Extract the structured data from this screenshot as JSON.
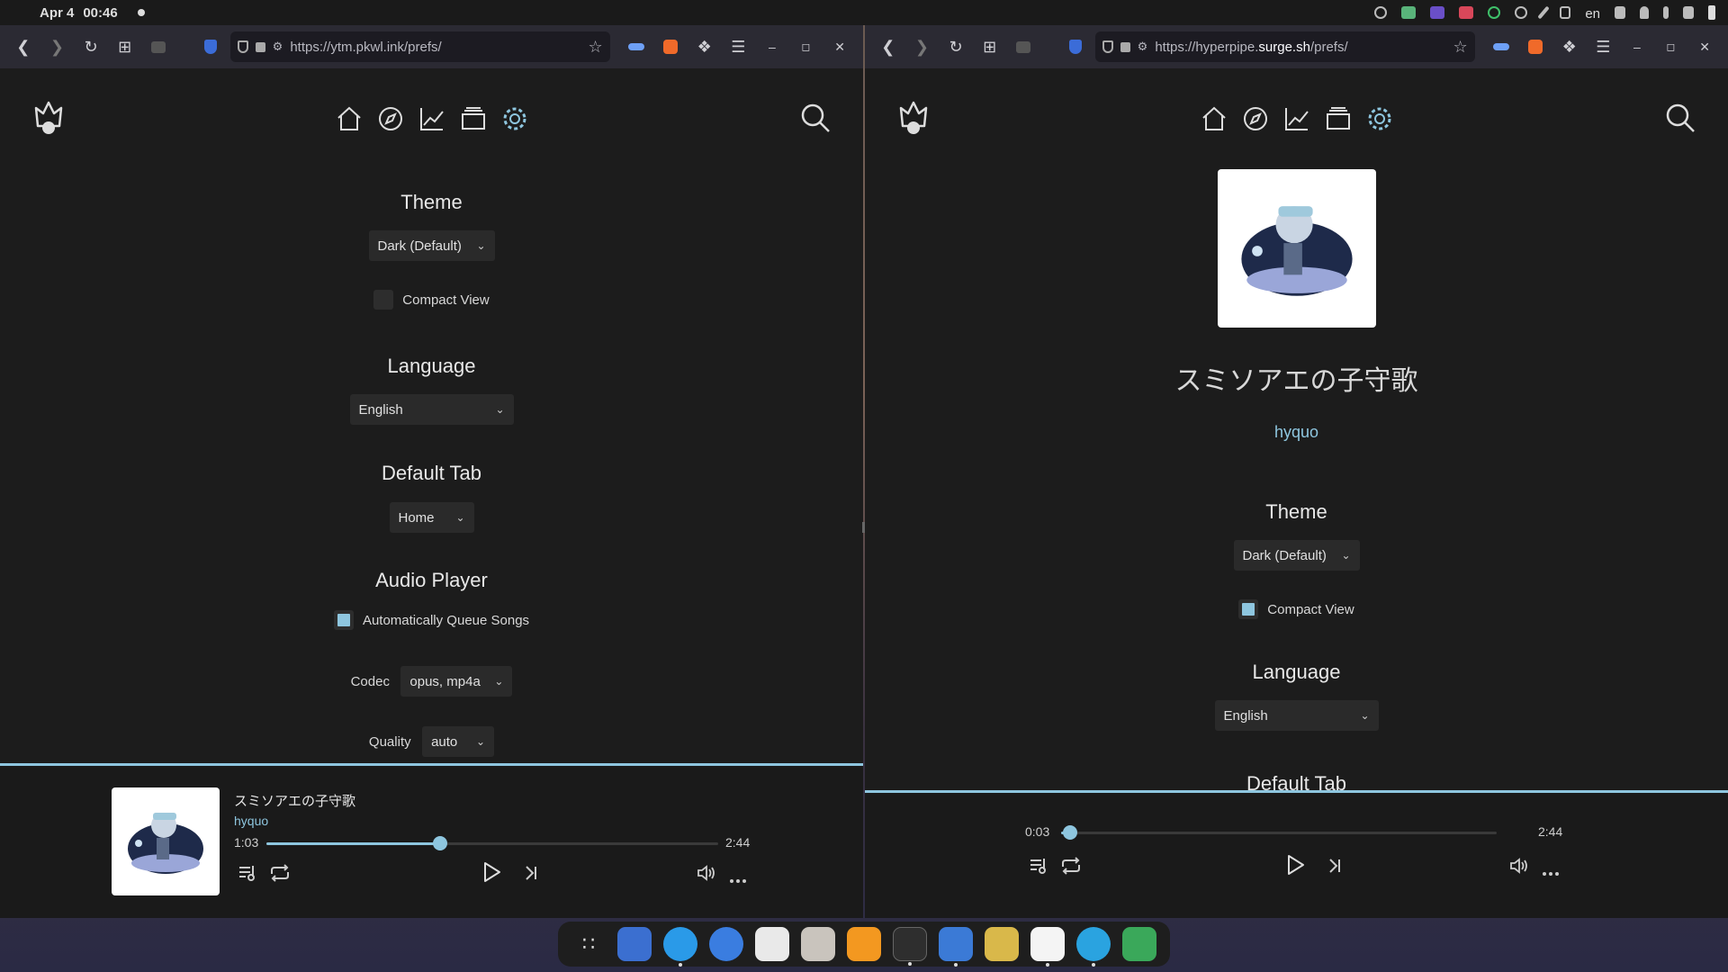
{
  "system": {
    "date": "Apr 4",
    "time": "00:46",
    "lang": "en"
  },
  "left": {
    "url_full": "https://ytm.pkwl.ink/prefs/",
    "theme": {
      "title": "Theme",
      "value": "Dark (Default)"
    },
    "compact": {
      "label": "Compact View",
      "checked": false
    },
    "language": {
      "title": "Language",
      "value": "English"
    },
    "default_tab": {
      "title": "Default Tab",
      "value": "Home"
    },
    "audio": {
      "title": "Audio Player",
      "auto_queue_label": "Automatically Queue Songs",
      "auto_queue_checked": true
    },
    "codec": {
      "label": "Codec",
      "value": "opus, mp4a"
    },
    "quality": {
      "label": "Quality",
      "value": "auto"
    },
    "player": {
      "title": "スミソアエの子守歌",
      "artist": "hyquo",
      "elapsed": "1:03",
      "duration": "2:44",
      "progress": 0.384
    }
  },
  "right": {
    "url_prefix": "https://hyperpipe.",
    "url_domain": "surge.sh",
    "url_suffix": "/prefs/",
    "song": {
      "title": "スミソアエの子守歌",
      "artist": "hyquo"
    },
    "theme": {
      "title": "Theme",
      "value": "Dark (Default)"
    },
    "compact": {
      "label": "Compact View",
      "checked": true
    },
    "language": {
      "title": "Language",
      "value": "English"
    },
    "default_tab": {
      "title": "Default Tab"
    },
    "player": {
      "elapsed": "0:03",
      "duration": "2:44",
      "progress": 0.02
    }
  },
  "colors": {
    "accent": "#8ec6df",
    "bg": "#1c1c1c",
    "toolbar": "#2b2a33",
    "urlbar": "#1c1b22"
  },
  "icons": {
    "nav": [
      "home-icon",
      "compass-icon",
      "trending-icon",
      "library-icon",
      "settings-icon"
    ],
    "player": [
      "queue-icon",
      "repeat-icon",
      "play-icon",
      "next-icon",
      "volume-icon",
      "more-icon"
    ]
  }
}
